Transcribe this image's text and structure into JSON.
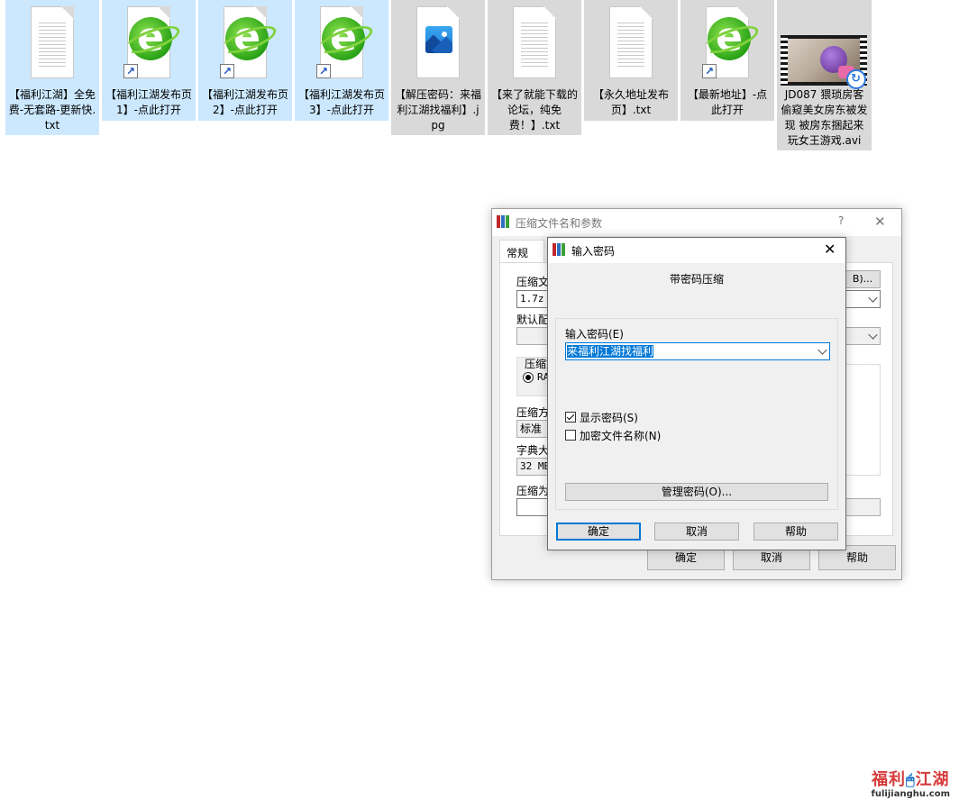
{
  "files": [
    {
      "name": "【福利江湖】全免费-无套路-更新快.txt",
      "icon": "text-file-icon"
    },
    {
      "name": "【福利江湖发布页1】-点此打开",
      "icon": "ie-shortcut-icon"
    },
    {
      "name": "【福利江湖发布页2】-点此打开",
      "icon": "ie-shortcut-icon"
    },
    {
      "name": "【福利江湖发布页3】-点此打开",
      "icon": "ie-shortcut-icon"
    },
    {
      "name": "【解压密码：来福利江湖找福利】.jpg",
      "icon": "image-file-icon"
    },
    {
      "name": "【来了就能下载的论坛，纯免费！】.txt",
      "icon": "text-file-icon"
    },
    {
      "name": "【永久地址发布页】.txt",
      "icon": "text-file-icon"
    },
    {
      "name": "【最新地址】-点此打开",
      "icon": "ie-shortcut-icon"
    },
    {
      "name": "JD087 猥琐房客偷窥美女房东被发现 被房东捆起来玩女王游戏.avi",
      "icon": "video-file-icon"
    }
  ],
  "archive_dialog": {
    "title": "压缩文件名和参数",
    "help_glyph": "?",
    "close_glyph": "✕",
    "tab_general": "常规",
    "label_archive_name": "压缩文",
    "archive_name_value": "1.7z",
    "browse_button_partial": "B)...",
    "label_default_profile": "默认配",
    "label_format": "压缩文",
    "format_radio_partial": "RA",
    "label_method": "压缩方",
    "method_value": "标准",
    "label_dict": "字典大",
    "dict_value": "32 MB",
    "label_split": "压缩为",
    "ok": "确定",
    "cancel": "取消",
    "help": "帮助"
  },
  "password_dialog": {
    "title": "输入密码",
    "close_glyph": "✕",
    "heading": "带密码压缩",
    "label_enter_password": "输入密码(E)",
    "password_value": "来福利江湖找福利",
    "show_password_label": "显示密码(S)",
    "show_password_checked": true,
    "encrypt_names_label": "加密文件名称(N)",
    "encrypt_names_checked": false,
    "manage_button": "管理密码(O)...",
    "ok": "确定",
    "cancel": "取消",
    "help": "帮助"
  },
  "watermark": {
    "main_part1": "福利",
    "main_part2": "江湖",
    "sub": "fulijianghu.com"
  },
  "colors": {
    "selection": "#cce8ff",
    "selection_gray": "#d9d9d9",
    "accent": "#0078d7",
    "winrar_red": "#c0282d"
  }
}
